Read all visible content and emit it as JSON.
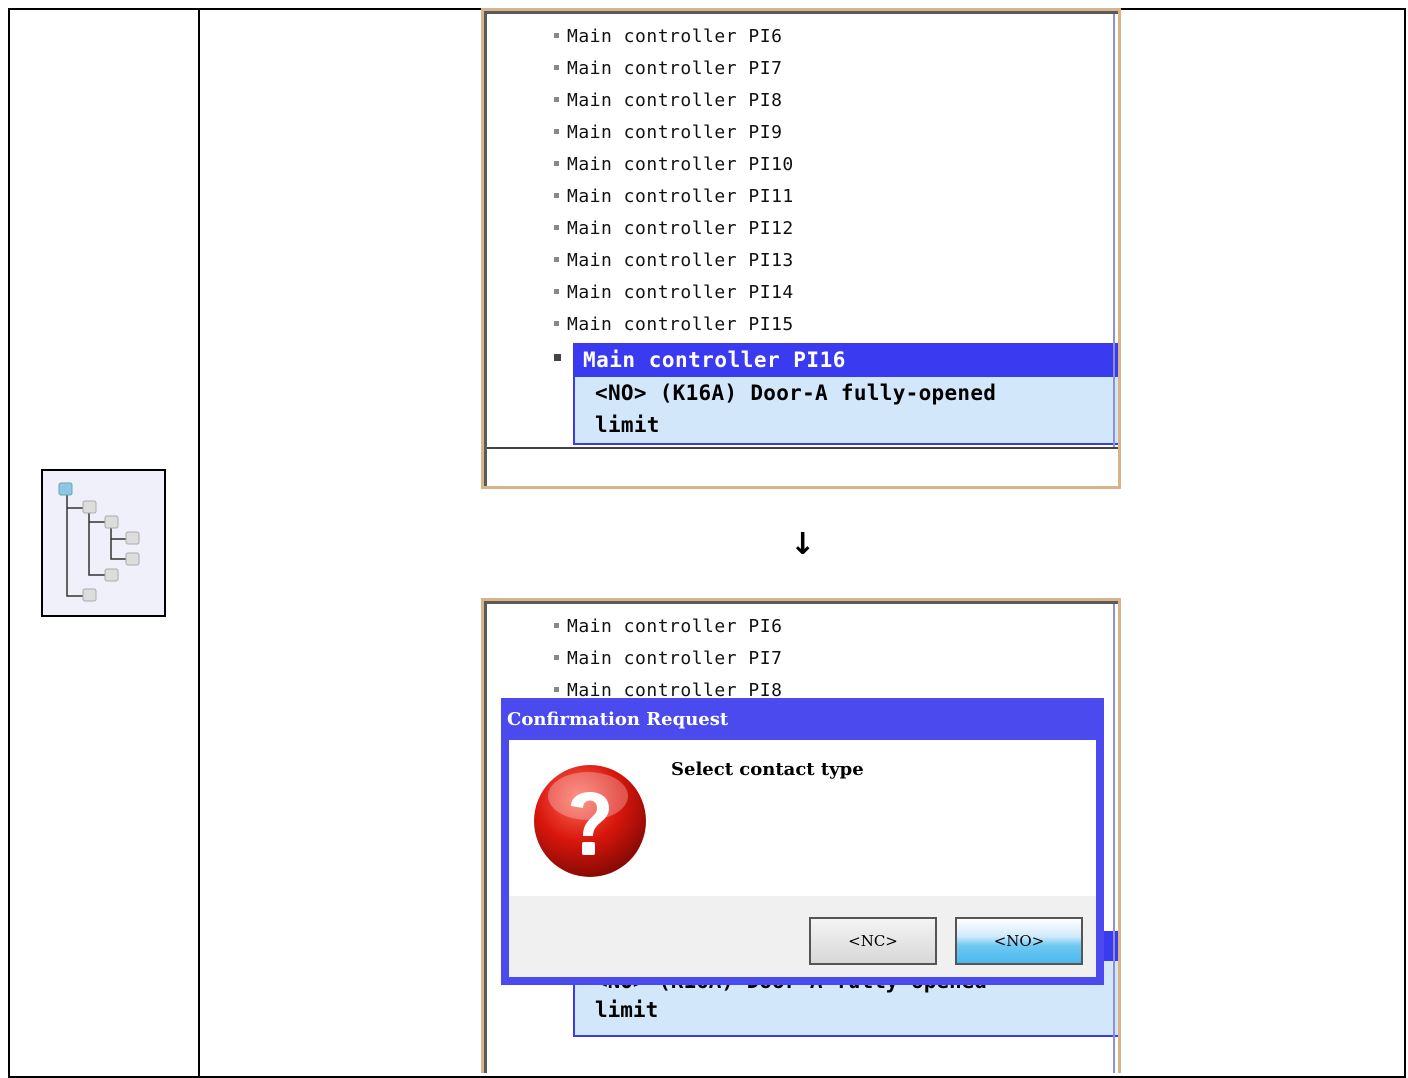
{
  "icon": {
    "name": "tree-icon"
  },
  "panel1": {
    "items": [
      "Main controller PI6",
      "Main controller PI7",
      "Main controller PI8",
      "Main controller PI9",
      "Main controller PI10",
      "Main controller PI11",
      "Main controller PI12",
      "Main controller PI13",
      "Main controller PI14",
      "Main controller PI15"
    ],
    "selected_title": "Main controller PI16",
    "selected_desc_line1": "<NO> (K16A) Door-A fully-opened",
    "selected_desc_line2": "limit"
  },
  "arrow": "↓",
  "panel2": {
    "items": [
      "Main controller PI6",
      "Main controller PI7",
      "Main controller PI8"
    ],
    "selected_desc_partial": "<NO> (K16A) Door-A fully-opened",
    "selected_desc_line2": "limit"
  },
  "dialog": {
    "title": "Confirmation Request",
    "message": "Select contact type",
    "icon": "question-icon",
    "buttons": {
      "nc": "<NC>",
      "no": "<NO>"
    }
  },
  "colors": {
    "selection": "#3a3af0",
    "selection_body": "#d3e7fb",
    "dialog_border": "#4a4aee"
  }
}
